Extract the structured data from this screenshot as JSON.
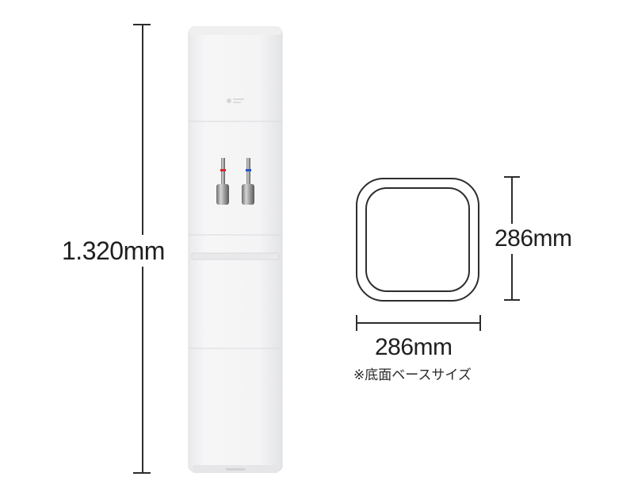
{
  "dimensions": {
    "height_label": "1.320mm",
    "depth_label": "286mm",
    "width_label": "286mm",
    "base_note": "※底面ベースサイズ"
  },
  "colors": {
    "line": "#2d2d2d",
    "body": "#f4f4f5",
    "hot_tap_ring": "#d9262c",
    "cold_tap_ring": "#2a55c9"
  },
  "icons": {
    "logo": "brand-logo-icon",
    "hot_tap": "hot-water-tap-icon",
    "cold_tap": "cold-water-tap-icon"
  }
}
